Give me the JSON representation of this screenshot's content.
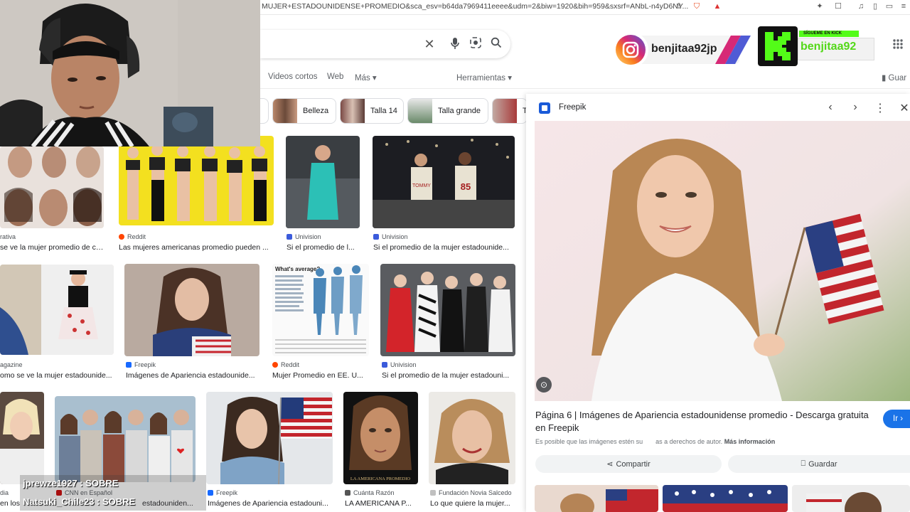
{
  "browser": {
    "url": "MUJER+ESTADOUNIDENSE+PROMEDIO&sca_esv=b64da7969411eeee&udm=2&biw=1920&bih=959&sxsrf=ANbL-n4yD6NY..."
  },
  "search": {
    "tabs": [
      "Videos cortos",
      "Web",
      "Más ▾"
    ],
    "tools_label": "Herramientas ▾",
    "saved_label": "Guar"
  },
  "chips": [
    {
      "label": "Belleza"
    },
    {
      "label": "Talla 14"
    },
    {
      "label": "Talla grande"
    },
    {
      "label": "Ta"
    }
  ],
  "results": [
    {
      "source": "rativa",
      "caption": "se ve la mujer promedio de cad...",
      "fav": "#8c8c8c"
    },
    {
      "source": "Reddit",
      "caption": "Las mujeres americanas promedio pueden ...",
      "fav": "#ff4500"
    },
    {
      "source": "Univision",
      "caption": "Si el promedio de l...",
      "fav": "#3b5bdb"
    },
    {
      "source": "Univision",
      "caption": "Si el promedio de la mujer estadounide...",
      "fav": "#3b5bdb"
    },
    {
      "source": "agazine",
      "caption": "omo se ve la mujer estadounide...",
      "fav": "#8c8c8c"
    },
    {
      "source": "Freepik",
      "caption": "Imágenes de Apariencia estadounide...",
      "fav": "#1769ff"
    },
    {
      "source": "Reddit",
      "caption": "Mujer Promedio en EE. U...",
      "fav": "#ff4500"
    },
    {
      "source": "Univision",
      "caption": "Si el promedio de la mujer estadouni...",
      "fav": "#3b5bdb"
    },
    {
      "source": "dia",
      "caption": "en los",
      "fav": "#8c8c8c"
    },
    {
      "source": "CNN en Español",
      "caption": "estadouniden...",
      "fav": "#cc0000"
    },
    {
      "source": "Freepik",
      "caption": "Imágenes de Apariencia estadouni...",
      "fav": "#1769ff"
    },
    {
      "source": "Cuánta Razón",
      "caption": "LA AMERICANA P...",
      "fav": "#555555"
    },
    {
      "source": "Fundación Novia Salcedo",
      "caption": "Lo que quiere la mujer...",
      "fav": "#c0c0c0"
    }
  ],
  "inline_text": {
    "what_average": "What's average?",
    "la_americana": "LA AMERICANA PROMEDIO",
    "tommy": "TOMMY",
    "number": "85"
  },
  "panel": {
    "source": "Freepik",
    "title": "Página 6 | Imágenes de Apariencia estadounidense promedio - Descarga gratuita en Freepik",
    "notice": "Es posible que las imágenes estén su",
    "notice2": "as a derechos de autor.",
    "more_info": "Más información",
    "share": "Compartir",
    "save": "Guardar",
    "visit": "Ir"
  },
  "stream": {
    "instagram_handle": "benjitaa92jp",
    "kick_tag": "SÍGUEME EN KICK",
    "kick_handle": "benjitaa92",
    "chat": [
      {
        "user": "jprewze1927",
        "msg": "SOBRE"
      },
      {
        "user": "Natsuki_Chile23",
        "msg": "SOBRE"
      }
    ]
  },
  "colors": {
    "accent": "#1a73e8",
    "kick_green": "#53fc18",
    "instagram": "#e1306c"
  }
}
